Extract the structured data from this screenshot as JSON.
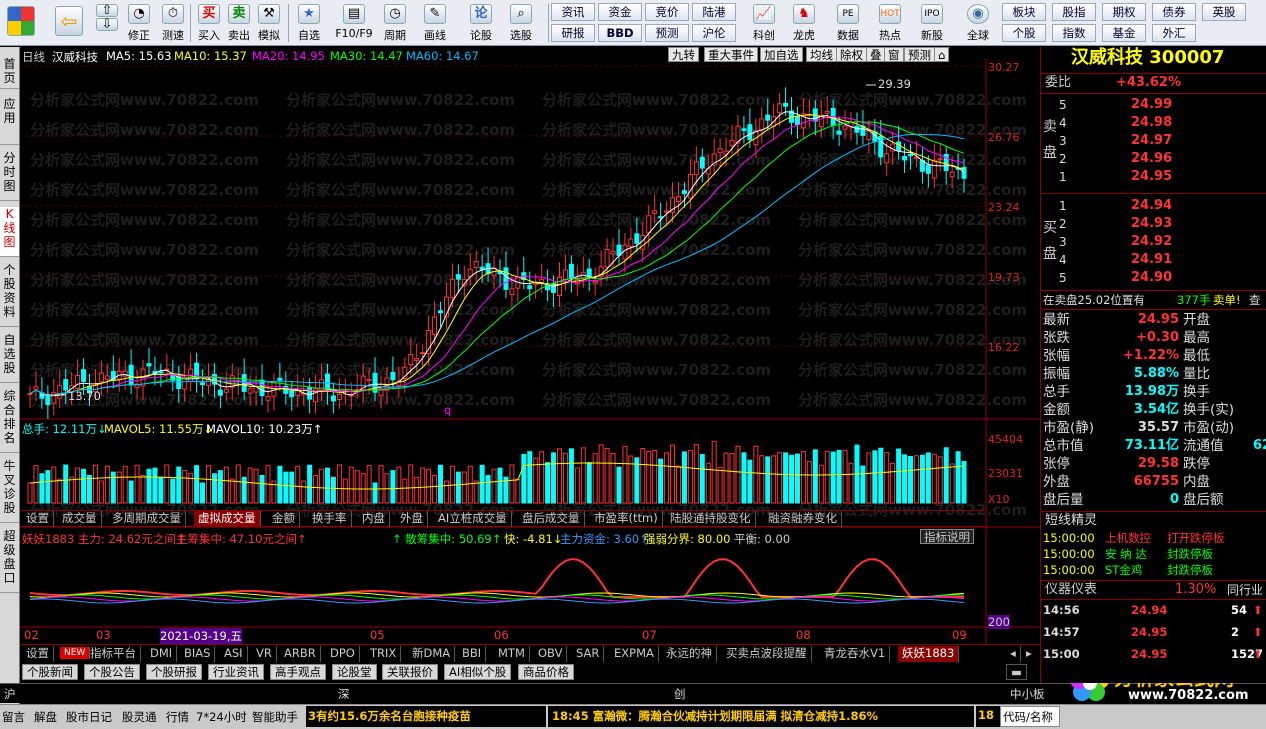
{
  "toolbar": {
    "buttons": [
      "修正",
      "测速",
      "买入",
      "卖出",
      "模拟",
      "自选",
      "F10/F9",
      "周期",
      "画线",
      "论股",
      "选股",
      "科创",
      "龙虎",
      "数据",
      "热点",
      "新股",
      "全球"
    ],
    "quick": [
      "资讯",
      "资金",
      "竞价",
      "陆港",
      "研报",
      "BBD",
      "预测",
      "沪伦",
      "板块",
      "股指",
      "期权",
      "债券",
      "英股",
      "个股",
      "指数",
      "基金",
      "外汇"
    ]
  },
  "sidenav": [
    "首页",
    "应用",
    "分时图",
    "K线图",
    "个股资料",
    "自选股",
    "综合排名",
    "牛叉诊股",
    "超级盘口"
  ],
  "chart": {
    "period": "日线",
    "stock_name": "汉威科技",
    "ma_labels": [
      "MA5: 15.63",
      "MA10: 15.37",
      "MA20: 14.95",
      "MA30: 14.47",
      "MA60: 14.67"
    ],
    "ma_colors": [
      "#ffffff",
      "#ffff00",
      "#ff00ff",
      "#00ff00",
      "#00bfff"
    ],
    "top_tabs": [
      "九转",
      "重大事件",
      "加自选",
      "均线",
      "除权",
      "叠",
      "窗",
      "预测"
    ],
    "yticks": [
      "30.27",
      "26.76",
      "23.24",
      "19.73",
      "16.22"
    ],
    "high_label": "29.39",
    "low_label": "13.70",
    "q_marker": "q",
    "vol_labels": [
      "总手: 12.11万↓",
      "MAVOL5: 11.55万↓",
      "MAVOL10: 10.23万↑"
    ],
    "vol_ticks": [
      "45404",
      "23031",
      "X10"
    ],
    "ind_tabs": [
      "设置",
      "成交量",
      "多周期成交量",
      "虚拟成交量",
      "金额",
      "换手率",
      "内盘",
      "外盘",
      "AI立桩成交量",
      "盘后成交量",
      "市盈率(ttm)",
      "陆股通持股变化",
      "融资融券变化"
    ],
    "osc_labels": [
      "妖妖1883 主力: 24.62元之间↑",
      "主筹集中: 47.10元之间↑",
      "↑ 散筹集中: 50.69↑",
      "快: -4.81↓",
      "主力资金: 3.60↑",
      "强弱分界: 80.00",
      "平衡: 0.00"
    ],
    "osc_help": "指标说明",
    "osc_tick": "200",
    "xlabels": [
      "02",
      "03",
      "2021-03-19,五",
      "05",
      "06",
      "07",
      "08",
      "09"
    ],
    "watermark": "分析家公式网www.70822.com"
  },
  "bottom_tabs": [
    "设置",
    "NEW",
    "指标平台",
    "DMI",
    "BIAS",
    "ASI",
    "VR",
    "ARBR",
    "DPO",
    "TRIX",
    "新DMA",
    "BBI",
    "MTM",
    "OBV",
    "SAR",
    "EXPMA",
    "永远的神",
    "买卖点波段提醒",
    "青龙吞水V1",
    "妖妖1883"
  ],
  "news_tabs": [
    "个股新闻",
    "个股公告",
    "个股研报",
    "行业资讯",
    "高手观点",
    "论股堂",
    "关联报价",
    "AI相似个股",
    "商品价格"
  ],
  "index_row": [
    "沪",
    "深",
    "创",
    "中小板"
  ],
  "statusbar": {
    "items": [
      "留言",
      "解盘",
      "股市日记",
      "股灵通",
      "行情",
      "7*24小时",
      "智能助手"
    ],
    "ticker1": "3有约15.6万余名台胞接种疫苗",
    "ticker2": "18:45 富瀚微：腾瀚合伙减持计划期限届满 拟清仓减持1.86%",
    "ticker3": "18",
    "code_input": "代码/名称"
  },
  "panel": {
    "title": "汉威科技 300007",
    "weibi_label": "委比",
    "weibi_value": "+43.62%",
    "sell_label": "卖盘",
    "buy_label": "买盘",
    "sells": [
      {
        "lv": "5",
        "p": "24.99"
      },
      {
        "lv": "4",
        "p": "24.98"
      },
      {
        "lv": "3",
        "p": "24.97"
      },
      {
        "lv": "2",
        "p": "24.96"
      },
      {
        "lv": "1",
        "p": "24.95"
      }
    ],
    "buys": [
      {
        "lv": "1",
        "p": "24.94"
      },
      {
        "lv": "2",
        "p": "24.93"
      },
      {
        "lv": "3",
        "p": "24.92"
      },
      {
        "lv": "4",
        "p": "24.91"
      },
      {
        "lv": "5",
        "p": "24.90"
      }
    ],
    "sell_notice": "在卖盘25.02位置有",
    "sell_notice_vol": "377手",
    "sell_notice_tag": "卖单!",
    "sell_notice_end": "查",
    "stats": [
      [
        "最新",
        "24.95",
        "开盘",
        ""
      ],
      [
        "张跌",
        "+0.30",
        "最高",
        ""
      ],
      [
        "张幅",
        "+1.22%",
        "最低",
        ""
      ],
      [
        "振幅",
        "5.88%",
        "量比",
        ""
      ],
      [
        "总手",
        "13.98万",
        "换手",
        ""
      ],
      [
        "金额",
        "3.54亿",
        "换手(实)",
        ""
      ],
      [
        "市盈(静)",
        "35.57",
        "市盈(动)",
        ""
      ],
      [
        "总市值",
        "73.11亿",
        "流通值",
        "62"
      ],
      [
        "张停",
        "29.58",
        "跌停",
        ""
      ],
      [
        "外盘",
        "66755",
        "内盘",
        ""
      ],
      [
        "盘后量",
        "0",
        "盘后额",
        ""
      ]
    ],
    "elf_title": "短线精灵",
    "elf": [
      {
        "t": "15:00:00",
        "n": "上机数控",
        "e": "打开跌停板"
      },
      {
        "t": "15:00:00",
        "n": "安 纳 达",
        "e": "封跌停板"
      },
      {
        "t": "15:00:00",
        "n": "ST金鸡",
        "e": "封跌停板"
      }
    ],
    "meter_label": "仪器仪表",
    "meter_value": "1.30%",
    "meter_tab": "同行业",
    "ticks": [
      {
        "t": "14:56",
        "p": "24.94",
        "v": "54"
      },
      {
        "t": "14:57",
        "p": "24.95",
        "v": "2"
      },
      {
        "t": "15:00",
        "p": "24.95",
        "v": "1527"
      }
    ],
    "logo_text": "分析家公式网",
    "logo_url": "www.70822.com"
  },
  "chart_data": {
    "type": "candlestick",
    "title": "汉威科技 300007 日线",
    "ylim": [
      13.0,
      30.27
    ],
    "x": [
      "02",
      "03",
      "03-19",
      "05",
      "06",
      "07",
      "08",
      "09"
    ],
    "close_approx": [
      13.9,
      14.8,
      15.2,
      14.6,
      14.3,
      14.2,
      15.0,
      20.5,
      19.4,
      20.0,
      22.6,
      26.0,
      28.0,
      27.5,
      25.8,
      24.95
    ],
    "high": 29.39,
    "low": 13.7,
    "volume_ticks": [
      45404,
      23031
    ],
    "ma": {
      "MA5": 15.63,
      "MA10": 15.37,
      "MA20": 14.95,
      "MA30": 14.47,
      "MA60": 14.67
    }
  }
}
